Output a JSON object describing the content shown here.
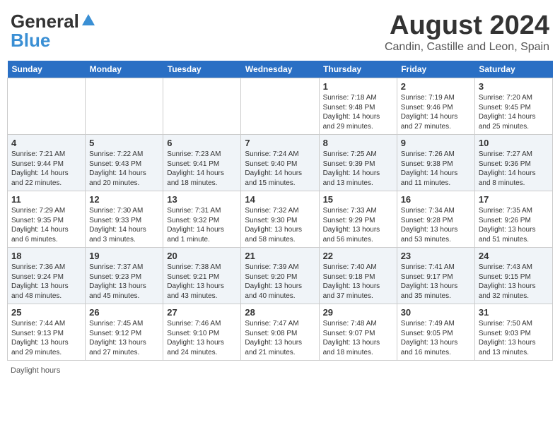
{
  "header": {
    "month_year": "August 2024",
    "location": "Candin, Castille and Leon, Spain",
    "logo_line1": "General",
    "logo_line2": "Blue"
  },
  "days_of_week": [
    "Sunday",
    "Monday",
    "Tuesday",
    "Wednesday",
    "Thursday",
    "Friday",
    "Saturday"
  ],
  "footer": {
    "label": "Daylight hours"
  },
  "weeks": [
    {
      "days": [
        {
          "num": "",
          "info": ""
        },
        {
          "num": "",
          "info": ""
        },
        {
          "num": "",
          "info": ""
        },
        {
          "num": "",
          "info": ""
        },
        {
          "num": "1",
          "info": "Sunrise: 7:18 AM\nSunset: 9:48 PM\nDaylight: 14 hours\nand 29 minutes."
        },
        {
          "num": "2",
          "info": "Sunrise: 7:19 AM\nSunset: 9:46 PM\nDaylight: 14 hours\nand 27 minutes."
        },
        {
          "num": "3",
          "info": "Sunrise: 7:20 AM\nSunset: 9:45 PM\nDaylight: 14 hours\nand 25 minutes."
        }
      ]
    },
    {
      "days": [
        {
          "num": "4",
          "info": "Sunrise: 7:21 AM\nSunset: 9:44 PM\nDaylight: 14 hours\nand 22 minutes."
        },
        {
          "num": "5",
          "info": "Sunrise: 7:22 AM\nSunset: 9:43 PM\nDaylight: 14 hours\nand 20 minutes."
        },
        {
          "num": "6",
          "info": "Sunrise: 7:23 AM\nSunset: 9:41 PM\nDaylight: 14 hours\nand 18 minutes."
        },
        {
          "num": "7",
          "info": "Sunrise: 7:24 AM\nSunset: 9:40 PM\nDaylight: 14 hours\nand 15 minutes."
        },
        {
          "num": "8",
          "info": "Sunrise: 7:25 AM\nSunset: 9:39 PM\nDaylight: 14 hours\nand 13 minutes."
        },
        {
          "num": "9",
          "info": "Sunrise: 7:26 AM\nSunset: 9:38 PM\nDaylight: 14 hours\nand 11 minutes."
        },
        {
          "num": "10",
          "info": "Sunrise: 7:27 AM\nSunset: 9:36 PM\nDaylight: 14 hours\nand 8 minutes."
        }
      ]
    },
    {
      "days": [
        {
          "num": "11",
          "info": "Sunrise: 7:29 AM\nSunset: 9:35 PM\nDaylight: 14 hours\nand 6 minutes."
        },
        {
          "num": "12",
          "info": "Sunrise: 7:30 AM\nSunset: 9:33 PM\nDaylight: 14 hours\nand 3 minutes."
        },
        {
          "num": "13",
          "info": "Sunrise: 7:31 AM\nSunset: 9:32 PM\nDaylight: 14 hours\nand 1 minute."
        },
        {
          "num": "14",
          "info": "Sunrise: 7:32 AM\nSunset: 9:30 PM\nDaylight: 13 hours\nand 58 minutes."
        },
        {
          "num": "15",
          "info": "Sunrise: 7:33 AM\nSunset: 9:29 PM\nDaylight: 13 hours\nand 56 minutes."
        },
        {
          "num": "16",
          "info": "Sunrise: 7:34 AM\nSunset: 9:28 PM\nDaylight: 13 hours\nand 53 minutes."
        },
        {
          "num": "17",
          "info": "Sunrise: 7:35 AM\nSunset: 9:26 PM\nDaylight: 13 hours\nand 51 minutes."
        }
      ]
    },
    {
      "days": [
        {
          "num": "18",
          "info": "Sunrise: 7:36 AM\nSunset: 9:24 PM\nDaylight: 13 hours\nand 48 minutes."
        },
        {
          "num": "19",
          "info": "Sunrise: 7:37 AM\nSunset: 9:23 PM\nDaylight: 13 hours\nand 45 minutes."
        },
        {
          "num": "20",
          "info": "Sunrise: 7:38 AM\nSunset: 9:21 PM\nDaylight: 13 hours\nand 43 minutes."
        },
        {
          "num": "21",
          "info": "Sunrise: 7:39 AM\nSunset: 9:20 PM\nDaylight: 13 hours\nand 40 minutes."
        },
        {
          "num": "22",
          "info": "Sunrise: 7:40 AM\nSunset: 9:18 PM\nDaylight: 13 hours\nand 37 minutes."
        },
        {
          "num": "23",
          "info": "Sunrise: 7:41 AM\nSunset: 9:17 PM\nDaylight: 13 hours\nand 35 minutes."
        },
        {
          "num": "24",
          "info": "Sunrise: 7:43 AM\nSunset: 9:15 PM\nDaylight: 13 hours\nand 32 minutes."
        }
      ]
    },
    {
      "days": [
        {
          "num": "25",
          "info": "Sunrise: 7:44 AM\nSunset: 9:13 PM\nDaylight: 13 hours\nand 29 minutes."
        },
        {
          "num": "26",
          "info": "Sunrise: 7:45 AM\nSunset: 9:12 PM\nDaylight: 13 hours\nand 27 minutes."
        },
        {
          "num": "27",
          "info": "Sunrise: 7:46 AM\nSunset: 9:10 PM\nDaylight: 13 hours\nand 24 minutes."
        },
        {
          "num": "28",
          "info": "Sunrise: 7:47 AM\nSunset: 9:08 PM\nDaylight: 13 hours\nand 21 minutes."
        },
        {
          "num": "29",
          "info": "Sunrise: 7:48 AM\nSunset: 9:07 PM\nDaylight: 13 hours\nand 18 minutes."
        },
        {
          "num": "30",
          "info": "Sunrise: 7:49 AM\nSunset: 9:05 PM\nDaylight: 13 hours\nand 16 minutes."
        },
        {
          "num": "31",
          "info": "Sunrise: 7:50 AM\nSunset: 9:03 PM\nDaylight: 13 hours\nand 13 minutes."
        }
      ]
    }
  ]
}
